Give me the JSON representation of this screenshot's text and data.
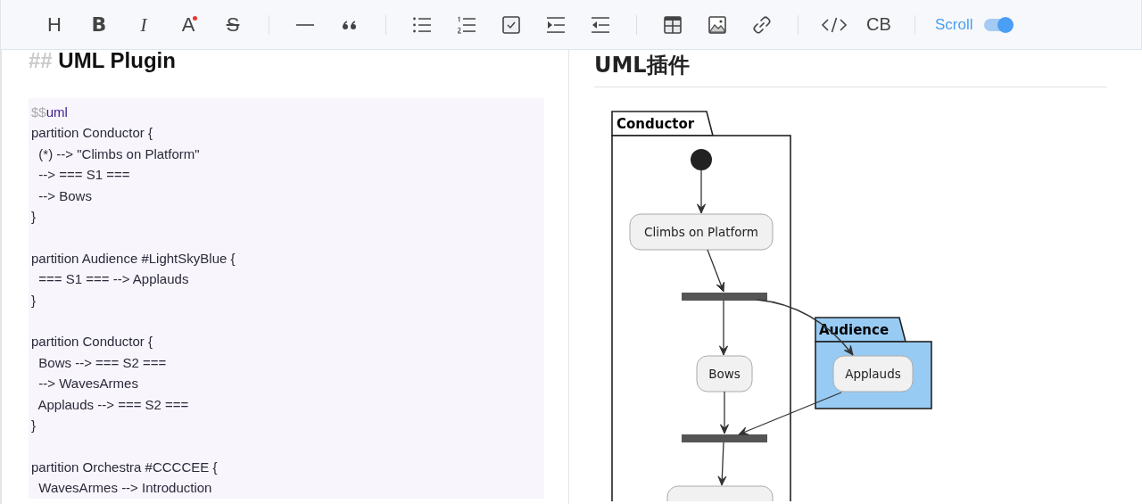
{
  "toolbar": {
    "groups": [
      [
        {
          "kind": "heading",
          "label": "H"
        },
        {
          "kind": "bold",
          "label": "B"
        },
        {
          "kind": "italic",
          "label": "I"
        },
        {
          "kind": "color",
          "label": "A"
        },
        {
          "kind": "strike",
          "label": "S"
        }
      ],
      [
        {
          "kind": "rule"
        },
        {
          "kind": "quote"
        }
      ],
      [
        {
          "kind": "bullets"
        },
        {
          "kind": "numbers"
        },
        {
          "kind": "checklist"
        },
        {
          "kind": "indent"
        },
        {
          "kind": "outdent"
        }
      ],
      [
        {
          "kind": "table"
        },
        {
          "kind": "image"
        },
        {
          "kind": "link"
        }
      ],
      [
        {
          "kind": "code"
        },
        {
          "kind": "text",
          "label": "CB"
        }
      ]
    ],
    "scroll": {
      "label": "Scroll",
      "on": true
    }
  },
  "editor": {
    "heading": {
      "marker": "##",
      "text": "UML Plugin"
    },
    "code": {
      "fence": "$$",
      "language": "uml",
      "blocks": [
        [
          "partition Conductor {",
          "  (*) --> \"Climbs on Platform\"",
          "  --> === S1 ===",
          "  --> Bows",
          "}"
        ],
        [
          "partition Audience #LightSkyBlue {",
          "  === S1 === --> Applauds",
          "}"
        ],
        [
          "partition Conductor {",
          "  Bows --> === S2 ===",
          "  --> WavesArmes",
          "  Applauds --> === S2 ===",
          "}"
        ],
        [
          "partition Orchestra #CCCCEE {",
          "  WavesArmes --> Introduction"
        ]
      ]
    }
  },
  "preview": {
    "heading": "UML插件",
    "diagram": {
      "partitions": [
        {
          "name": "Conductor",
          "color": "#ffffff"
        },
        {
          "name": "Audience",
          "color": "#97cbf3"
        }
      ],
      "activities": [
        "Climbs on Platform",
        "Bows",
        "Applauds"
      ]
    }
  }
}
